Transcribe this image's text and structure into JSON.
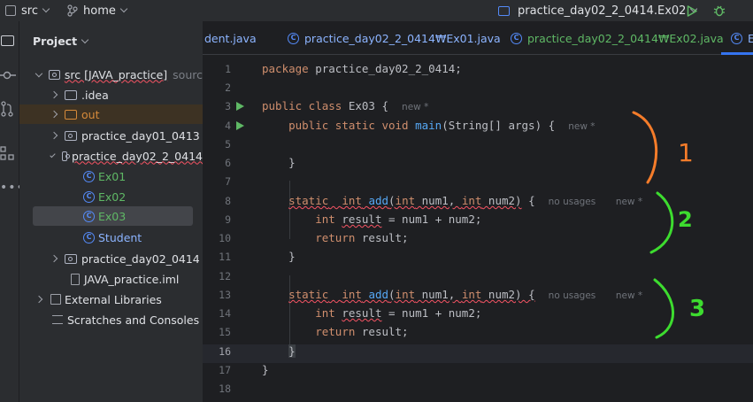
{
  "topbar": {
    "project_label": "src",
    "branch_label": "home",
    "run_config": "practice_day02_2_0414.Ex02"
  },
  "project_panel": {
    "title": "Project",
    "tree": [
      {
        "label": "src [JAVA_practice]",
        "suffix": "sourc"
      },
      {
        "label": ".idea"
      },
      {
        "label": "out"
      },
      {
        "label": "practice_day01_0413"
      },
      {
        "label": "practice_day02_2_0414"
      },
      {
        "label": "Ex01"
      },
      {
        "label": "Ex02"
      },
      {
        "label": "Ex03"
      },
      {
        "label": "Student"
      },
      {
        "label": "practice_day02_0414"
      },
      {
        "label": "JAVA_practice.iml"
      },
      {
        "label": "External Libraries"
      },
      {
        "label": "Scratches and Consoles"
      }
    ]
  },
  "tabs": [
    {
      "label": "dent.java"
    },
    {
      "label": "practice_day02_2_0414₩Ex01.java"
    },
    {
      "label": "practice_day02_2_0414₩Ex02.java"
    },
    {
      "label": "E"
    }
  ],
  "editor": {
    "line_numbers": [
      "1",
      "2",
      "3",
      "4",
      "5",
      "6",
      "7",
      "8",
      "9",
      "10",
      "11",
      "12",
      "13",
      "14",
      "15",
      "16",
      "17",
      "18"
    ],
    "current_line": "16",
    "hints": {
      "new": "new *",
      "no_usages": "no usages"
    }
  },
  "annotations": [
    {
      "text": "1",
      "color": "#f57c2a"
    },
    {
      "text": "2",
      "color": "#3ddc2f"
    },
    {
      "text": "3",
      "color": "#3ddc2f"
    }
  ],
  "colors": {
    "accent": "#3574f0",
    "panel_bg": "#2b2d30",
    "editor_bg": "#1e1f22",
    "run_green": "#5fb865"
  }
}
